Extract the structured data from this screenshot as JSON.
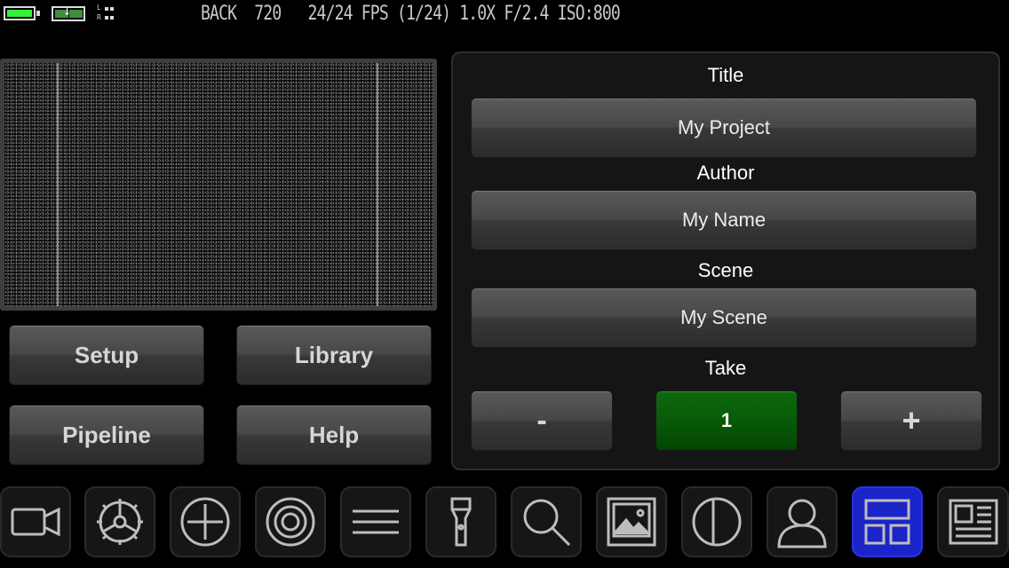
{
  "status": {
    "readout": "BACK  720   24/24 FPS (1/24) 1.0X F/2.4 ISO:800",
    "audio_left": "L",
    "audio_right": "R"
  },
  "colors": {
    "battery": "#38f038",
    "take_active": "#0a5e0a",
    "toolbar_active": "#1a24c8"
  },
  "left_buttons": {
    "setup": "Setup",
    "library": "Library",
    "pipeline": "Pipeline",
    "help": "Help"
  },
  "form": {
    "title_label": "Title",
    "title_value": "My Project",
    "author_label": "Author",
    "author_value": "My Name",
    "scene_label": "Scene",
    "scene_value": "My Scene",
    "take_label": "Take",
    "take_minus": "-",
    "take_value": "1",
    "take_plus": "+"
  },
  "toolbar": {
    "items": [
      {
        "icon": "video-camera-icon",
        "active": false
      },
      {
        "icon": "gear-icon",
        "active": false
      },
      {
        "icon": "crosshair-plus-icon",
        "active": false
      },
      {
        "icon": "target-icon",
        "active": false
      },
      {
        "icon": "menu-lines-icon",
        "active": false
      },
      {
        "icon": "flashlight-icon",
        "active": false
      },
      {
        "icon": "magnifier-icon",
        "active": false
      },
      {
        "icon": "image-icon",
        "active": false
      },
      {
        "icon": "contrast-icon",
        "active": false
      },
      {
        "icon": "person-icon",
        "active": false
      },
      {
        "icon": "layout-grid-icon",
        "active": true
      },
      {
        "icon": "news-layout-icon",
        "active": false
      }
    ]
  }
}
